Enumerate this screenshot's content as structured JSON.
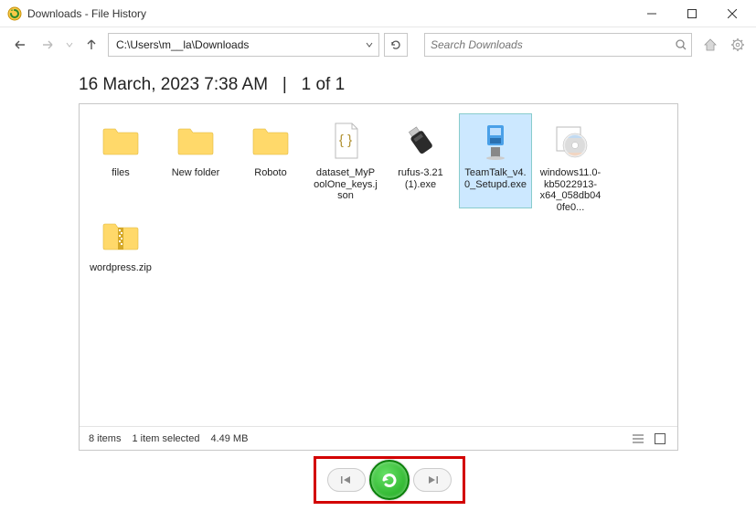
{
  "window": {
    "title": "Downloads - File History"
  },
  "toolbar": {
    "path": "C:\\Users\\m__la\\Downloads",
    "search_placeholder": "Search Downloads"
  },
  "version": {
    "timestamp": "16 March, 2023 7:38 AM",
    "separator": "|",
    "position": "1 of 1"
  },
  "files": [
    {
      "name": "files",
      "kind": "folder",
      "selected": false
    },
    {
      "name": "New folder",
      "kind": "folder",
      "selected": false
    },
    {
      "name": "Roboto",
      "kind": "folder",
      "selected": false
    },
    {
      "name": "dataset_MyPoolOne_keys.json",
      "kind": "json",
      "selected": false
    },
    {
      "name": "rufus-3.21 (1).exe",
      "kind": "usb-exe",
      "selected": false
    },
    {
      "name": "TeamTalk_v4.0_Setupd.exe",
      "kind": "setup-exe",
      "selected": true
    },
    {
      "name": "windows11.0-kb5022913-x64_058db040fe0...",
      "kind": "disc-exe",
      "selected": false
    },
    {
      "name": "wordpress.zip",
      "kind": "zip",
      "selected": false
    }
  ],
  "status": {
    "items": "8 items",
    "selected": "1 item selected",
    "size": "4.49 MB"
  }
}
